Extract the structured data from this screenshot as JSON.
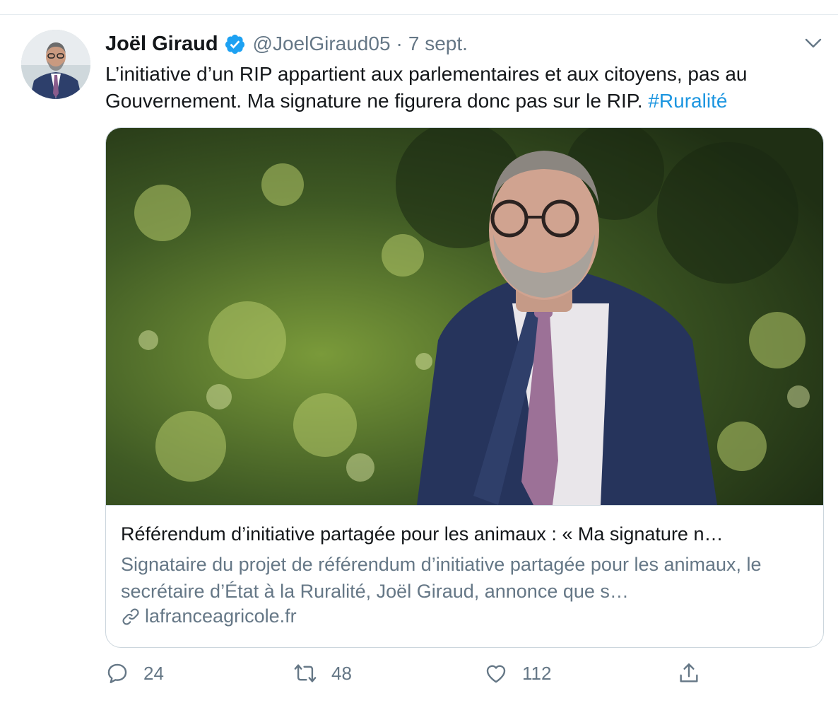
{
  "tweet": {
    "author_name": "Joël Giraud",
    "handle": "@JoelGiraud05",
    "separator": "·",
    "date": "7 sept.",
    "text": "L’initiative d’un RIP appartient aux parlementaires et aux citoyens, pas au Gouvernement. Ma signature ne figurera donc pas sur le RIP. ",
    "hashtag": "#Ruralité"
  },
  "card": {
    "title": "Référendum d’initiative partagée pour les animaux : « Ma signature n…",
    "description": "Signataire du projet de référendum d’initiative partagée pour les animaux, le secrétaire d’État à la Ruralité, Joël Giraud, annonce que s…",
    "domain": "lafranceagricole.fr"
  },
  "actions": {
    "replies": "24",
    "retweets": "48",
    "likes": "112"
  },
  "colors": {
    "link": "#1b95e0",
    "secondary_text": "#657786",
    "border": "#ccd6dd"
  },
  "icons": [
    "verified-badge-icon",
    "chevron-down-icon",
    "link-icon",
    "reply-icon",
    "retweet-icon",
    "like-icon",
    "share-icon"
  ]
}
